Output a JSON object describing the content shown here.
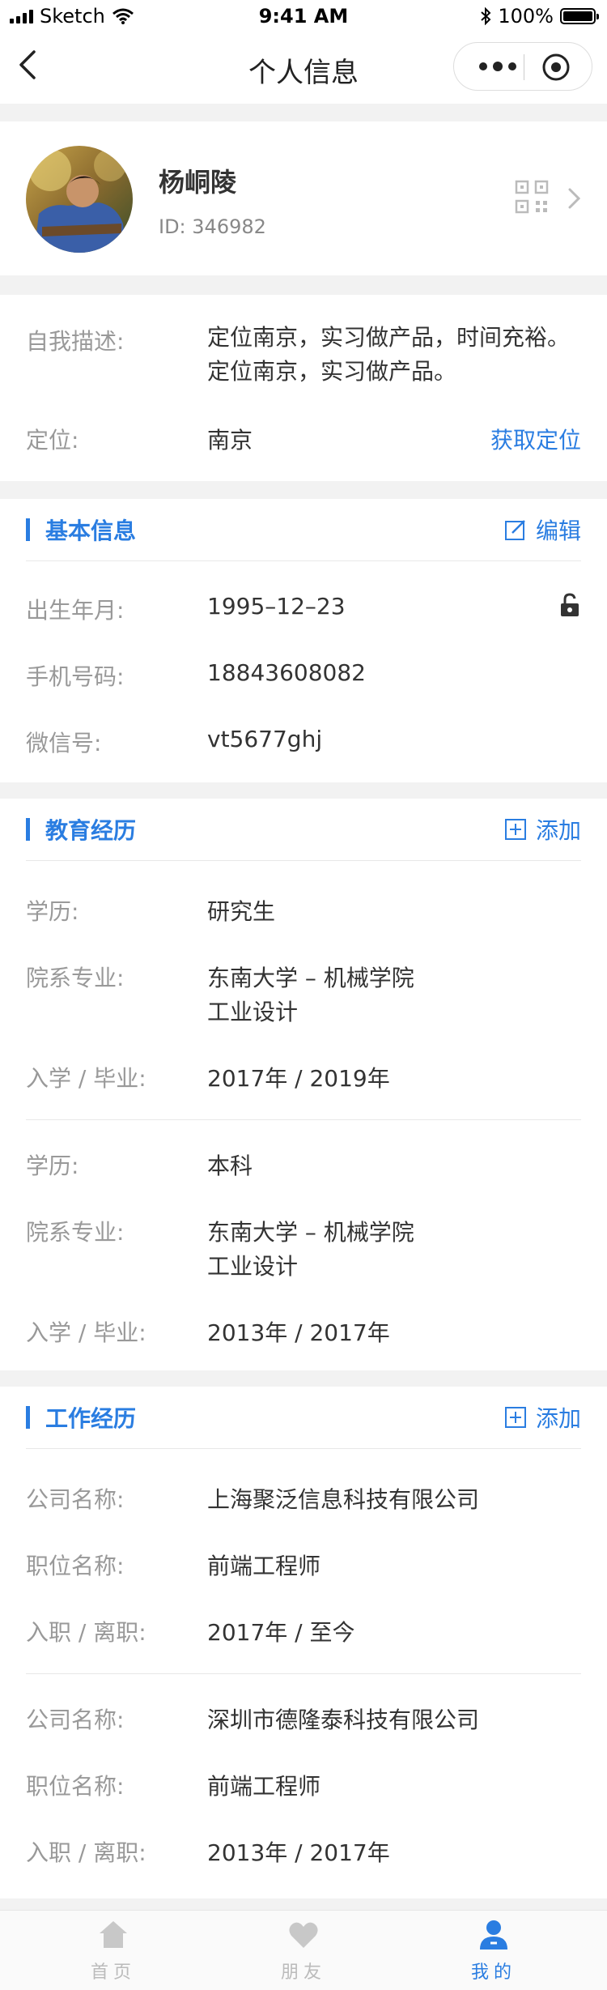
{
  "status_bar": {
    "carrier": "Sketch",
    "time": "9:41 AM",
    "battery": "100%",
    "battery_level": 1.0
  },
  "nav": {
    "title": "个人信息"
  },
  "profile": {
    "name": "杨峒陵",
    "id_text": "ID: 346982"
  },
  "intro": {
    "desc_label": "自我描述:",
    "desc_value": "定位南京，实习做产品，时间充裕。定位南京，实习做产品。",
    "location_label": "定位:",
    "location_value": "南京",
    "location_action": "获取定位"
  },
  "basic": {
    "title": "基本信息",
    "action": "编辑",
    "rows": [
      {
        "label": "出生年月:",
        "value": "1995–12–23"
      },
      {
        "label": "手机号码:",
        "value": "18843608082"
      },
      {
        "label": "微信号:",
        "value": "vt5677ghj"
      }
    ]
  },
  "education": {
    "title": "教育经历",
    "action": "添加",
    "entries": [
      {
        "degree_label": "学历:",
        "degree": "研究生",
        "school_label": "院系专业:",
        "school_line1": "东南大学 – 机械学院",
        "school_line2": "工业设计",
        "period_label": "入学 / 毕业:",
        "period": "2017年 / 2019年"
      },
      {
        "degree_label": "学历:",
        "degree": "本科",
        "school_label": "院系专业:",
        "school_line1": "东南大学 – 机械学院",
        "school_line2": "工业设计",
        "period_label": "入学 / 毕业:",
        "period": "2013年 / 2017年"
      }
    ]
  },
  "work": {
    "title": "工作经历",
    "action": "添加",
    "entries": [
      {
        "company_label": "公司名称:",
        "company": "上海聚泛信息科技有限公司",
        "position_label": "职位名称:",
        "position": "前端工程师",
        "period_label": "入职 / 离职:",
        "period": "2017年 / 至今"
      },
      {
        "company_label": "公司名称:",
        "company": "深圳市德隆泰科技有限公司",
        "position_label": "职位名称:",
        "position": "前端工程师",
        "period_label": "入职 / 离职:",
        "period": "2013年 / 2017年"
      }
    ]
  },
  "tabbar": {
    "items": [
      {
        "label": "首页",
        "icon": "home-icon",
        "active": false
      },
      {
        "label": "朋友",
        "icon": "heart-icon",
        "active": false
      },
      {
        "label": "我的",
        "icon": "person-icon",
        "active": true
      }
    ]
  },
  "colors": {
    "accent": "#2a7de1",
    "label": "#999999",
    "text": "#333333",
    "background": "#f2f2f2"
  }
}
